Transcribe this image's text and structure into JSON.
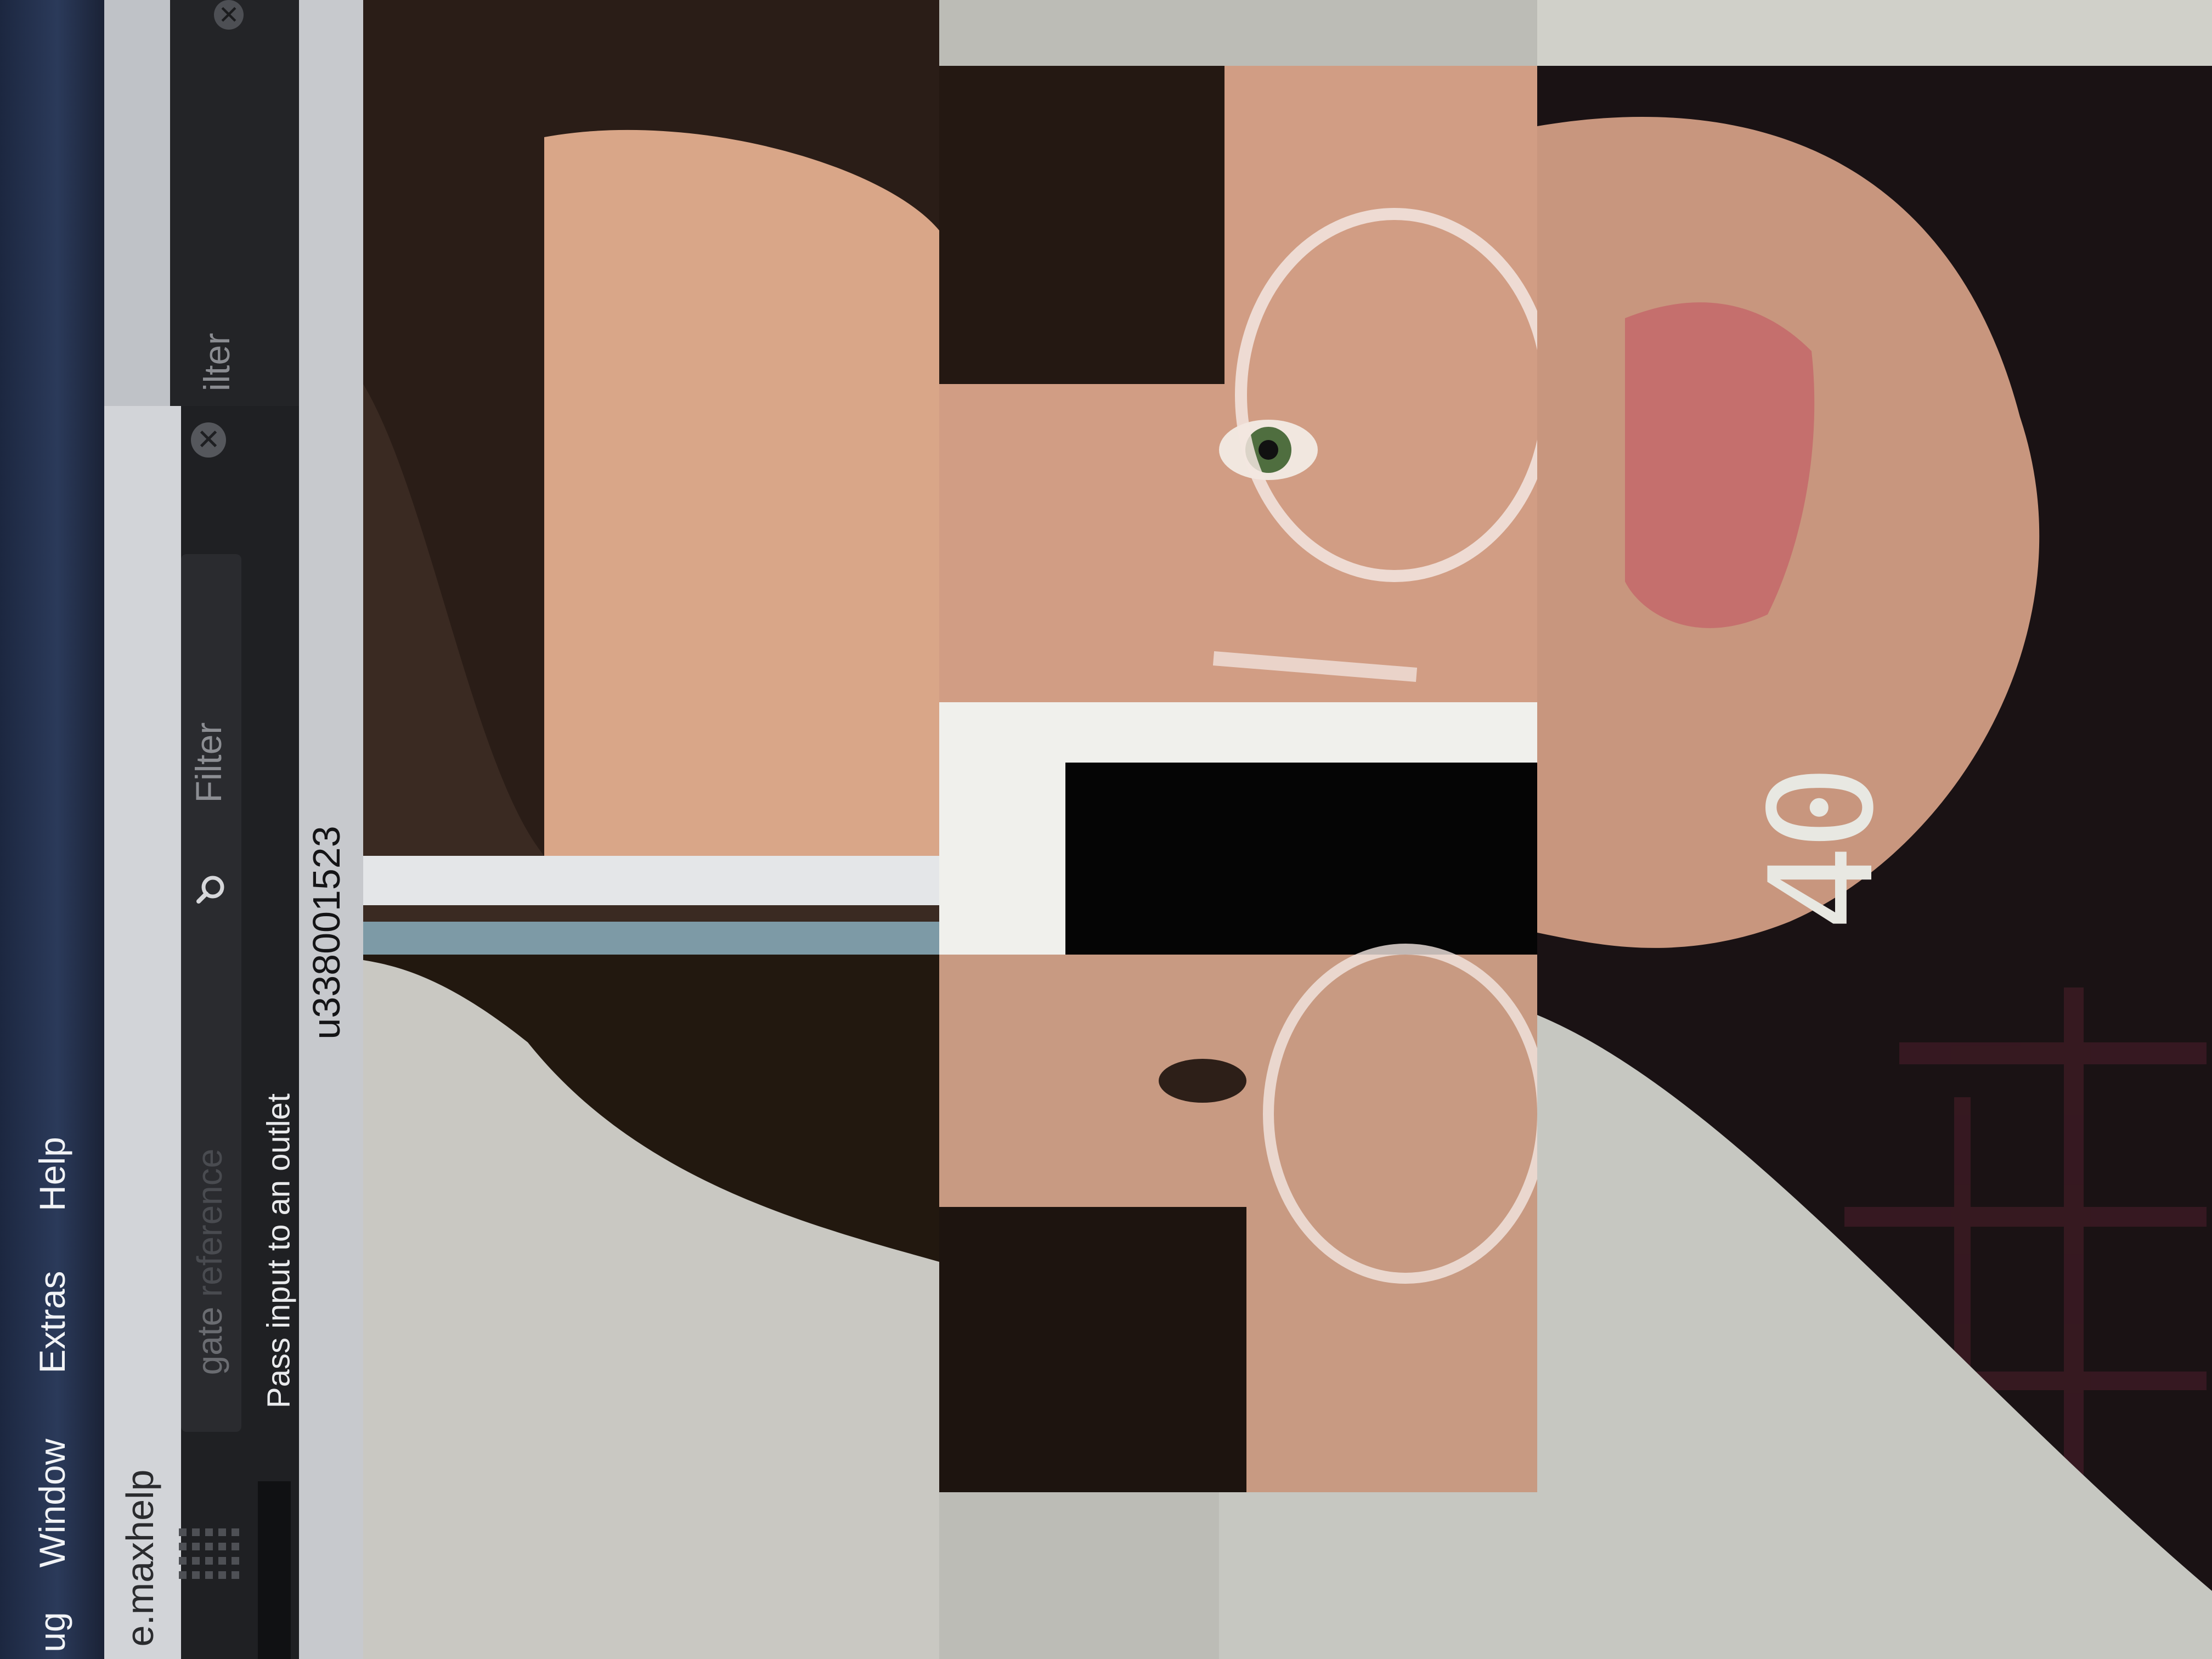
{
  "menubar": {
    "items": [
      "ug",
      "Window",
      "Extras",
      "Help"
    ]
  },
  "document": {
    "title": "e.maxhelp"
  },
  "search": {
    "placeholder": "Filter",
    "ghost_placeholder": "ilter"
  },
  "reference_list": {
    "entry_name": "gate",
    "entry_kind": "reference",
    "description": "Pass input to an outlet"
  },
  "object": {
    "id": "u338001523"
  },
  "camera_overlay": {
    "phone_readout": "40"
  },
  "icons": [
    "close-icon",
    "search-icon",
    "grid-icon"
  ]
}
